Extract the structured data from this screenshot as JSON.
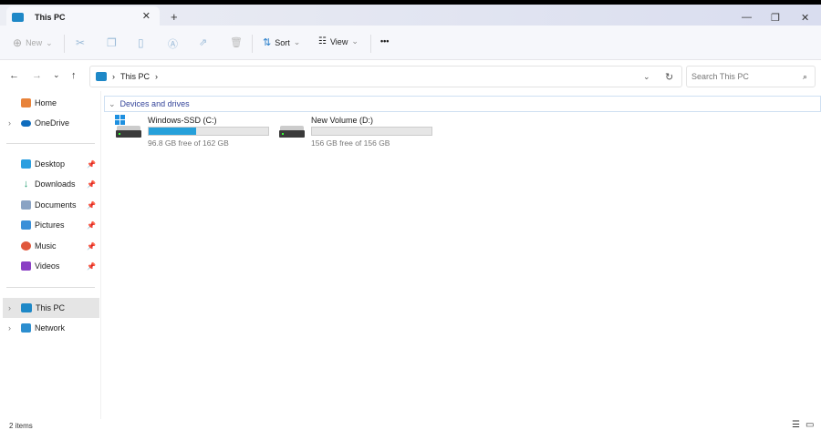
{
  "tab": {
    "title": "This PC"
  },
  "toolbar": {
    "new": "New",
    "sort": "Sort",
    "view": "View",
    "more": "•••"
  },
  "address": {
    "crumb": "This PC"
  },
  "search": {
    "placeholder": "Search This PC"
  },
  "sidebar": {
    "home": "Home",
    "onedrive": "OneDrive",
    "quick": [
      "Desktop",
      "Downloads",
      "Documents",
      "Pictures",
      "Music",
      "Videos"
    ],
    "thispc": "This PC",
    "network": "Network"
  },
  "content": {
    "group": "Devices and drives",
    "drives": [
      {
        "name": "Windows-SSD (C:)",
        "free": "96.8 GB free of 162 GB",
        "used_fraction": 0.4
      },
      {
        "name": "New Volume (D:)",
        "free": "156 GB free of 156 GB",
        "used_fraction": 0.0
      }
    ]
  },
  "status": {
    "items": "2 items"
  },
  "colors": {
    "accent": "#26a0da",
    "group": "#35459a"
  }
}
